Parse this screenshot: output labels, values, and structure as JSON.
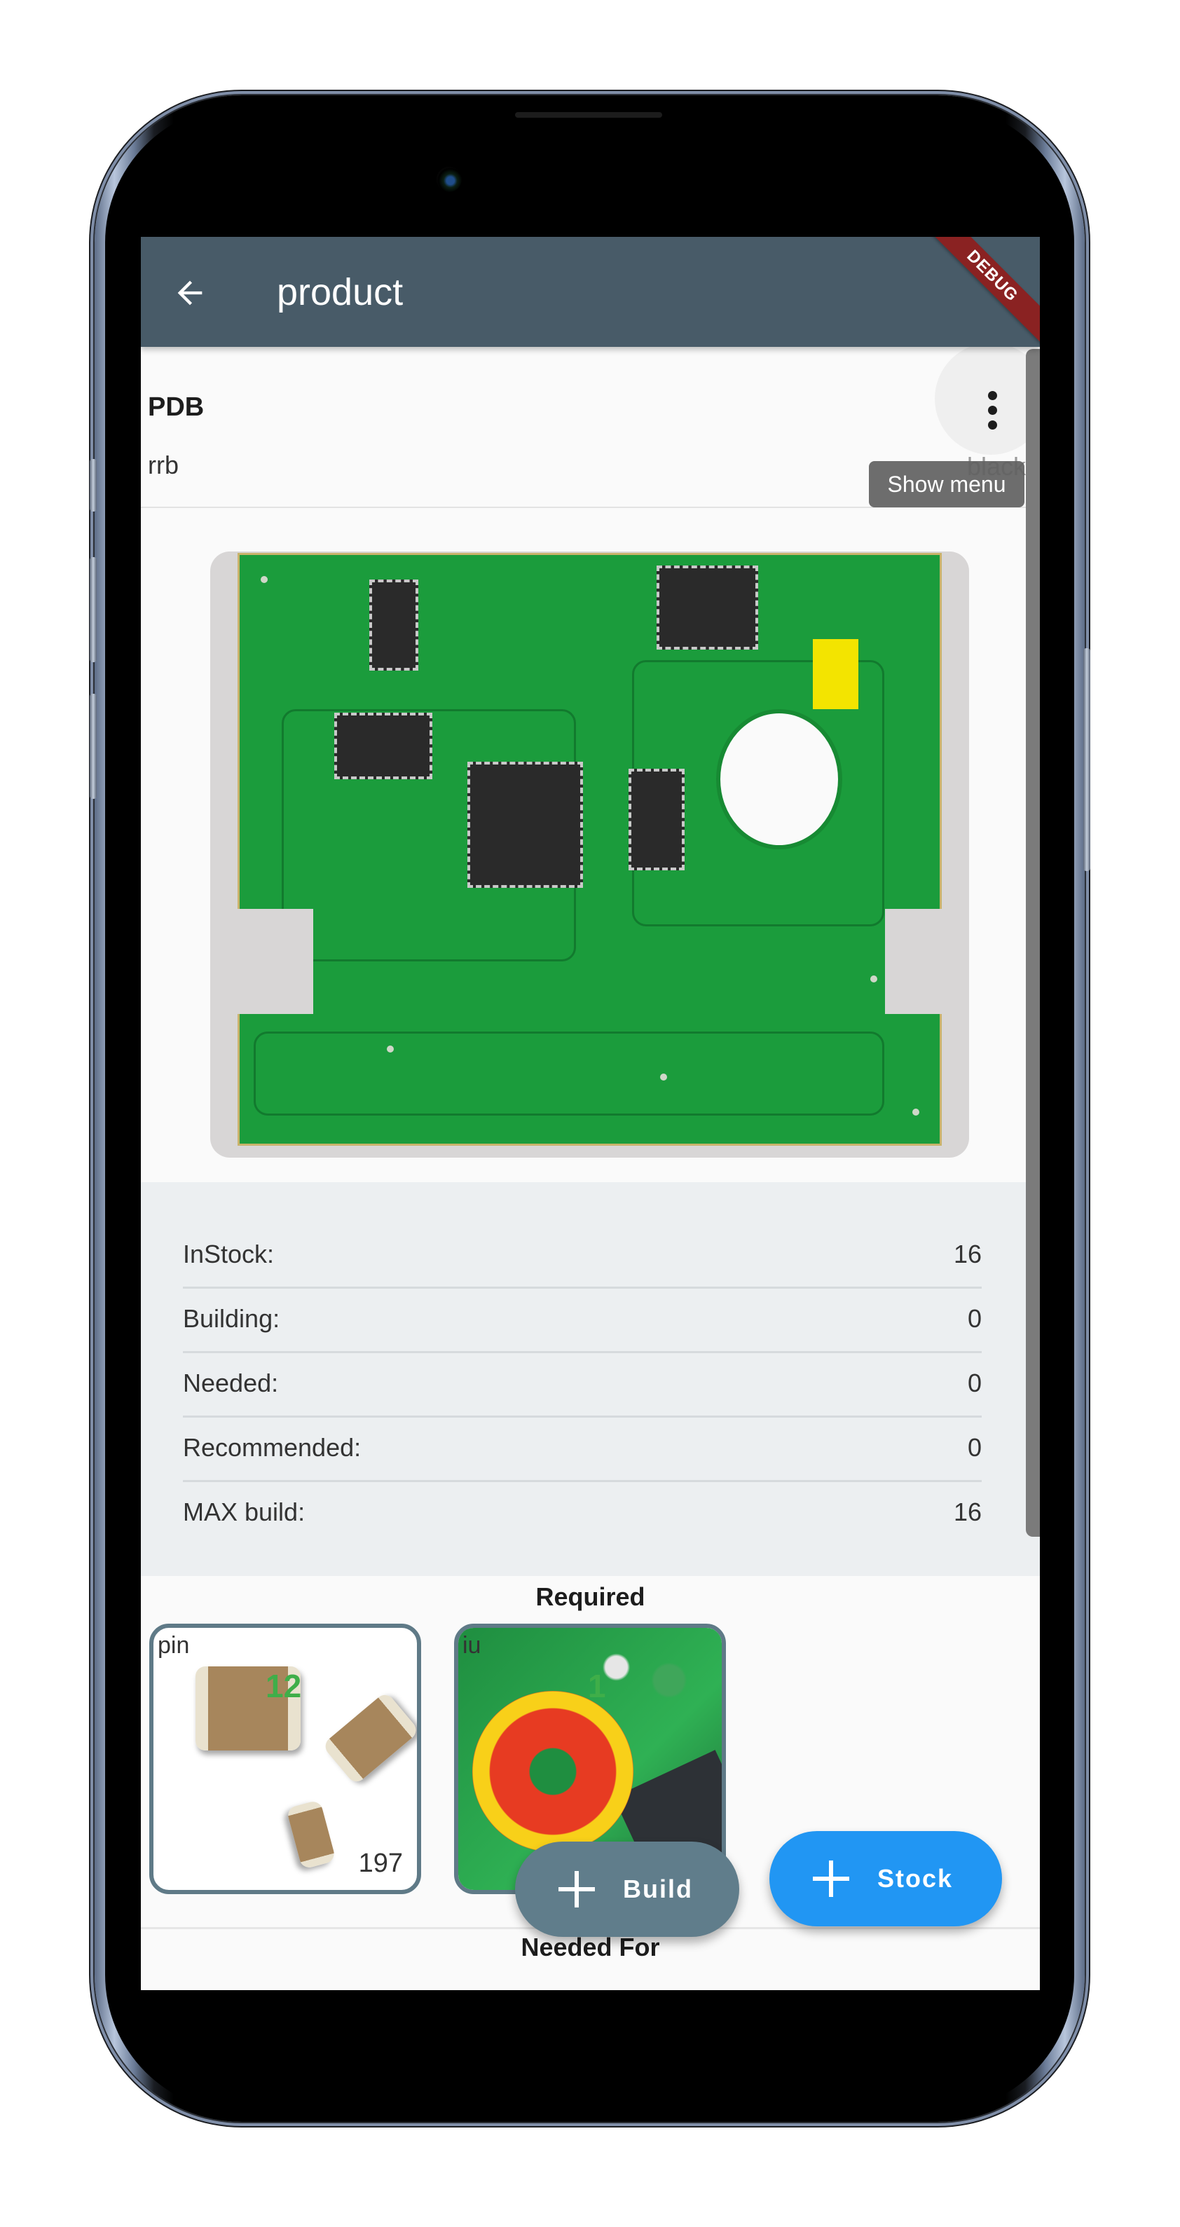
{
  "app_bar": {
    "title": "product",
    "back_icon": "arrow-back-icon",
    "debug_banner": "DEBUG"
  },
  "header": {
    "name": "PDB",
    "subtitle": "rrb",
    "color_label": "black",
    "menu_icon": "more-vert-icon",
    "menu_tooltip": "Show menu"
  },
  "product_image": {
    "description": "green printed circuit board"
  },
  "stats": [
    {
      "label": "InStock:",
      "value": "16"
    },
    {
      "label": "Building:",
      "value": "0"
    },
    {
      "label": "Needed:",
      "value": "0"
    },
    {
      "label": "Recommended:",
      "value": "0"
    },
    {
      "label": "MAX build:",
      "value": "16"
    }
  ],
  "required": {
    "title": "Required",
    "parts": [
      {
        "name": "pin",
        "quantity": "12",
        "stock": "197",
        "image": "smd capacitors"
      },
      {
        "name": "iu",
        "quantity": "1",
        "stock": "",
        "image": "toroid inductor on pcb"
      }
    ]
  },
  "needed_for": {
    "title": "Needed For"
  },
  "actions": {
    "build_label": "Build",
    "stock_label": "Stock",
    "add_icon": "plus-icon"
  },
  "colors": {
    "app_bar": "#485b68",
    "stats_bg": "#eceff1",
    "card_border": "#5f7a87",
    "qty_green": "#3fae49",
    "build_fab": "#607d8b",
    "stock_fab": "#2196f3",
    "debug_ribbon": "#8a2222"
  }
}
